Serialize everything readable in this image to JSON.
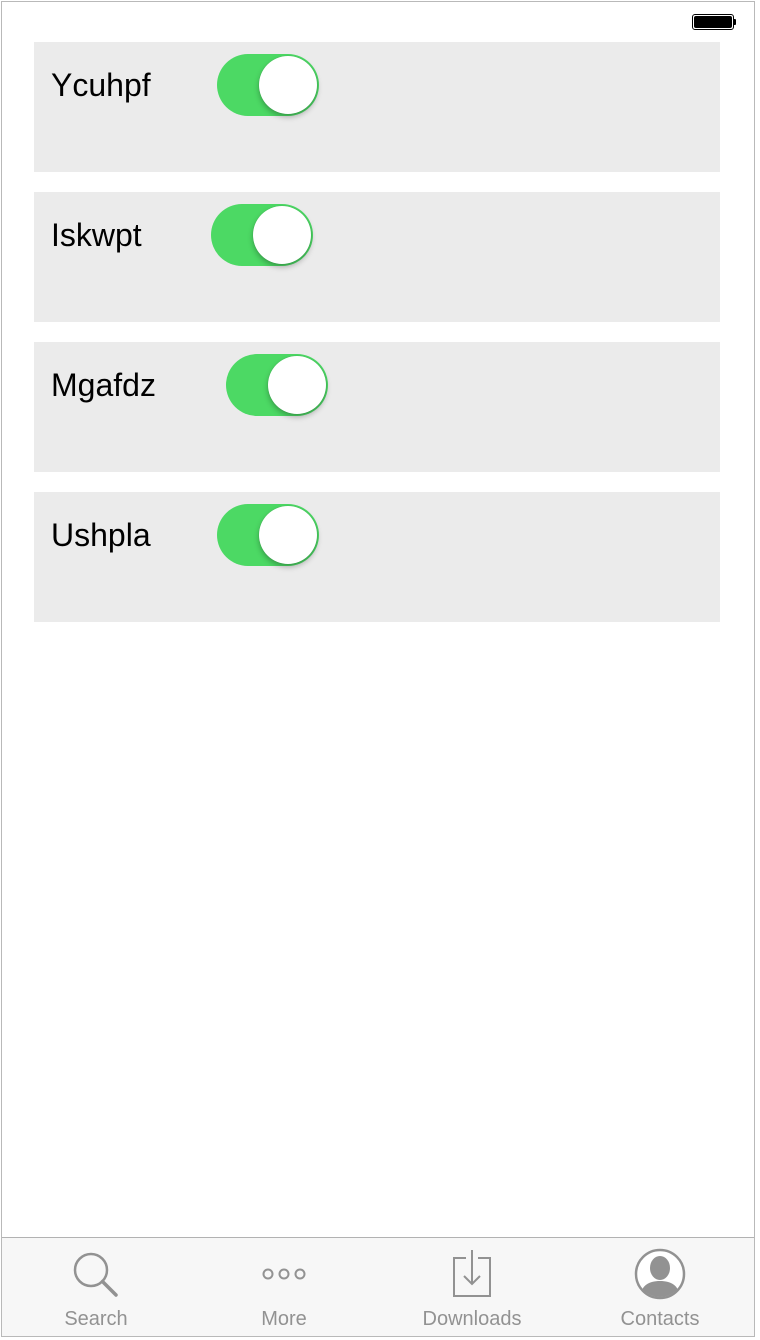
{
  "status_bar": {
    "battery": "full"
  },
  "settings": {
    "items": [
      {
        "label": "Ycuhpf",
        "enabled": true
      },
      {
        "label": "Iskwpt",
        "enabled": true
      },
      {
        "label": "Mgafdz",
        "enabled": true
      },
      {
        "label": "Ushpla",
        "enabled": true
      }
    ]
  },
  "tabbar": {
    "tabs": [
      {
        "label": "Search",
        "icon": "search-icon"
      },
      {
        "label": "More",
        "icon": "more-icon"
      },
      {
        "label": "Downloads",
        "icon": "downloads-icon"
      },
      {
        "label": "Contacts",
        "icon": "contacts-icon"
      }
    ]
  },
  "colors": {
    "toggle_on": "#4cd964",
    "card_background": "#ebebeb",
    "tab_inactive": "#929292"
  }
}
